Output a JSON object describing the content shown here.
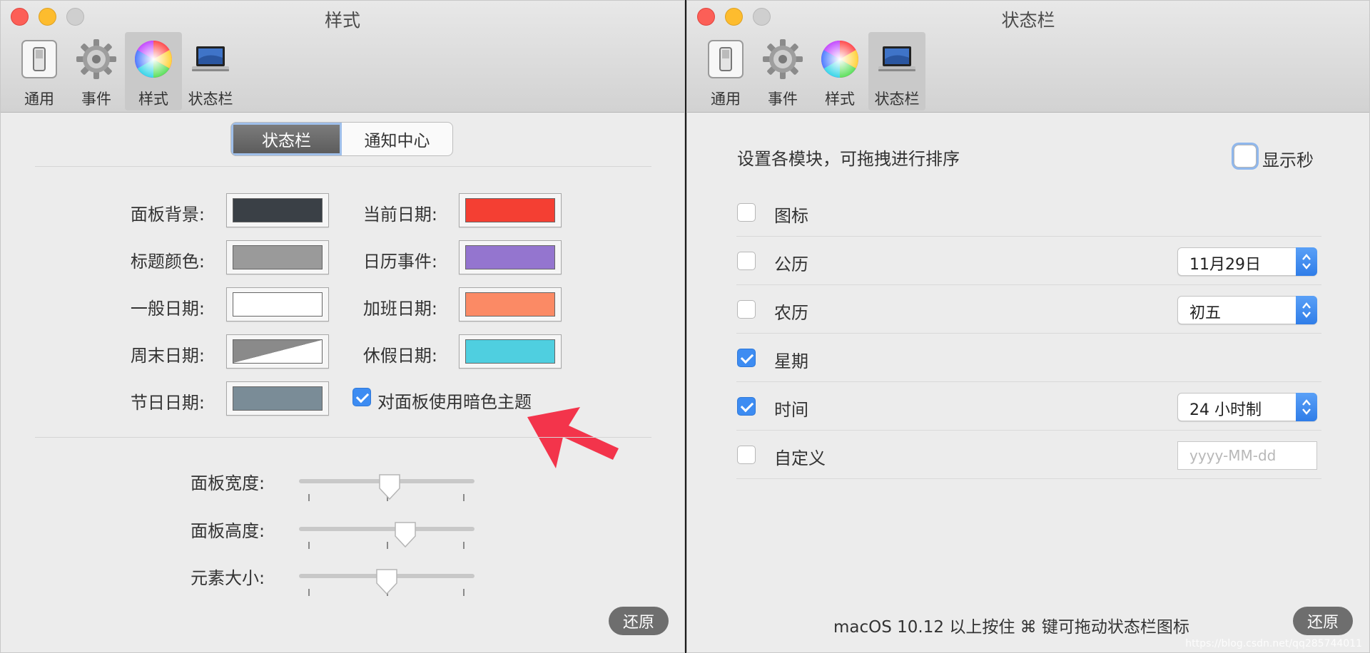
{
  "left_window": {
    "title": "样式",
    "toolbar": [
      {
        "label": "通用",
        "icon": "switch-icon"
      },
      {
        "label": "事件",
        "icon": "gear-icon"
      },
      {
        "label": "样式",
        "icon": "color-wheel-icon",
        "active": true
      },
      {
        "label": "状态栏",
        "icon": "laptop-icon"
      }
    ],
    "segments": [
      "状态栏",
      "通知中心"
    ],
    "selected_segment": "状态栏",
    "colors": [
      {
        "label": "面板背景:",
        "color": "#3a4046"
      },
      {
        "label": "当前日期:",
        "color": "#f43f33"
      },
      {
        "label": "标题颜色:",
        "color": "#9a9a9a"
      },
      {
        "label": "日历事件:",
        "color": "#9475cf"
      },
      {
        "label": "一般日期:",
        "color": "#ffffff"
      },
      {
        "label": "加班日期:",
        "color": "#fb8a65"
      },
      {
        "label": "周末日期:",
        "color": "#8a8a8a"
      },
      {
        "label": "休假日期:",
        "color": "#4fcfe0"
      },
      {
        "label": "节日日期:",
        "color": "#7a8c97"
      }
    ],
    "dark_theme_label": "对面板使用暗色主题",
    "dark_theme_checked": true,
    "sliders": [
      {
        "label": "面板宽度:",
        "value": 0.5
      },
      {
        "label": "面板高度:",
        "value": 0.6
      },
      {
        "label": "元素大小:",
        "value": 0.5
      }
    ],
    "restore_label": "还原"
  },
  "right_window": {
    "title": "状态栏",
    "toolbar": [
      {
        "label": "通用",
        "icon": "switch-icon"
      },
      {
        "label": "事件",
        "icon": "gear-icon"
      },
      {
        "label": "样式",
        "icon": "color-wheel-icon"
      },
      {
        "label": "状态栏",
        "icon": "laptop-icon",
        "active": true
      }
    ],
    "description": "设置各模块，可拖拽进行排序",
    "show_seconds_label": "显示秒",
    "show_seconds_checked": false,
    "modules": [
      {
        "label": "图标",
        "checked": false
      },
      {
        "label": "公历",
        "checked": false,
        "popup": "11月29日"
      },
      {
        "label": "农历",
        "checked": false,
        "popup": "初五"
      },
      {
        "label": "星期",
        "checked": true
      },
      {
        "label": "时间",
        "checked": true,
        "popup": "24 小时制"
      },
      {
        "label": "自定义",
        "checked": false,
        "placeholder": "yyyy-MM-dd"
      }
    ],
    "footer_note": "macOS 10.12 以上按住 ⌘ 键可拖动状态栏图标",
    "restore_label": "还原",
    "watermark": "https://blog.csdn.net/qq285744011"
  }
}
